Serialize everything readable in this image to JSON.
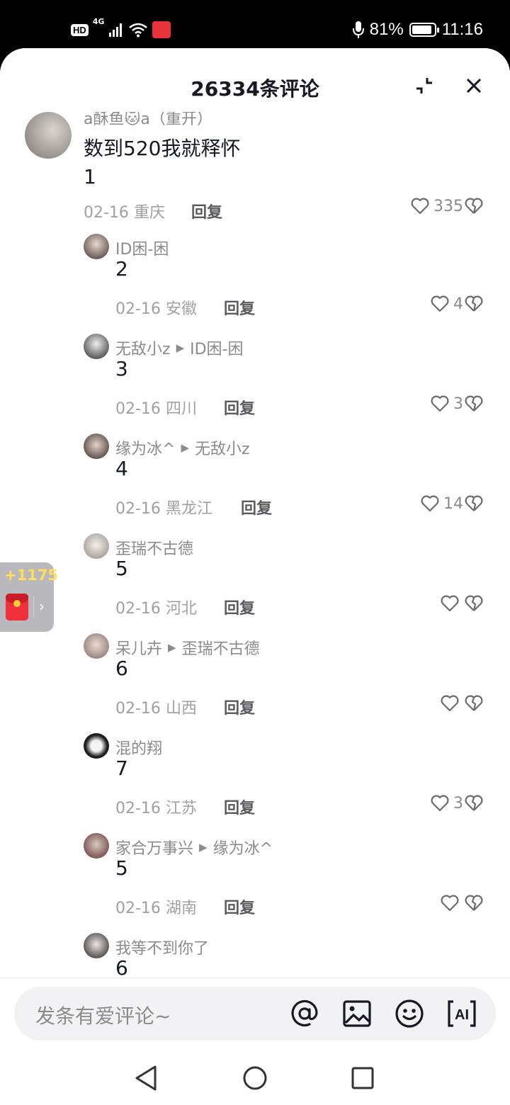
{
  "status_bar": {
    "hd": "HD",
    "network": "4G",
    "battery_pct": "81%",
    "battery_level": 0.81,
    "time": "11:16"
  },
  "sheet": {
    "title": "26334条评论",
    "minimize_icon": "collapse-icon",
    "close_icon": "close-icon"
  },
  "comments": [
    {
      "user": "a酥鱼🐱a（重开）",
      "reply_to": "",
      "text": "数到520我就释怀\n1",
      "date": "02-16",
      "location": "重庆",
      "reply": "回复",
      "likes": "335"
    },
    {
      "user": "ID困-困",
      "reply_to": "",
      "text": "2",
      "date": "02-16",
      "location": "安徽",
      "reply": "回复",
      "likes": "4"
    },
    {
      "user": "无敌小z",
      "reply_to": "ID困-困",
      "text": "3",
      "date": "02-16",
      "location": "四川",
      "reply": "回复",
      "likes": "3"
    },
    {
      "user": "缘为冰^",
      "reply_to": "无敌小z",
      "text": "4",
      "date": "02-16",
      "location": "黑龙江",
      "reply": "回复",
      "likes": "14"
    },
    {
      "user": "歪瑞不古德",
      "reply_to": "",
      "text": "5",
      "date": "02-16",
      "location": "河北",
      "reply": "回复",
      "likes": ""
    },
    {
      "user": "呆儿卉",
      "reply_to": "歪瑞不古德",
      "text": "6",
      "date": "02-16",
      "location": "山西",
      "reply": "回复",
      "likes": ""
    },
    {
      "user": "混的翔",
      "reply_to": "",
      "text": "7",
      "date": "02-16",
      "location": "江苏",
      "reply": "回复",
      "likes": "3"
    },
    {
      "user": "家合万事兴",
      "reply_to": "缘为冰^",
      "text": "5",
      "date": "02-16",
      "location": "湖南",
      "reply": "回复",
      "likes": ""
    },
    {
      "user": "我等不到你了",
      "reply_to": "",
      "text": "6",
      "date": "",
      "location": "",
      "reply": "",
      "likes": ""
    }
  ],
  "red_packet": {
    "count": "+1175",
    "arrow": "›"
  },
  "input": {
    "placeholder": "发条有爱评论~",
    "icons": [
      "at-icon",
      "image-icon",
      "emoji-icon",
      "ai-icon"
    ],
    "ai_label": "AI"
  },
  "nav": {
    "icons": [
      "back-icon",
      "home-icon",
      "recents-icon"
    ]
  },
  "colors": {
    "accent_red": "#f0313c",
    "reward_yellow": "#ffde59",
    "text_dark": "#161823",
    "text_gray": "#8a8a8f"
  }
}
